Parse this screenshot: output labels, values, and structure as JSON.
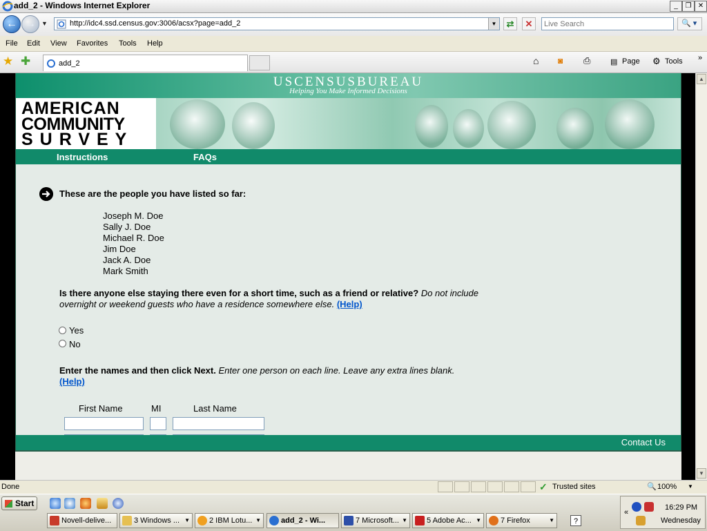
{
  "window": {
    "title": "add_2 - Windows Internet Explorer"
  },
  "address": {
    "url": "http://idc4.ssd.census.gov:3006/acsx?page=add_2",
    "search_placeholder": "Live Search"
  },
  "menu": [
    "File",
    "Edit",
    "View",
    "Favorites",
    "Tools",
    "Help"
  ],
  "tab": {
    "label": "add_2"
  },
  "commandbar": {
    "page_label": "Page",
    "tools_label": "Tools"
  },
  "banner": {
    "bureau": "USCENSUSBUREAU",
    "tagline": "Helping You Make Informed Decisions"
  },
  "logo": {
    "line1": "AMERICAN",
    "line2": "COMMUNITY",
    "line3": "SURVEY"
  },
  "nav": {
    "instructions": "Instructions",
    "faqs": "FAQs"
  },
  "listing": {
    "heading": "These are the people you have listed so far:",
    "people": [
      "Joseph M. Doe",
      "Sally J. Doe",
      "Michael R. Doe",
      "Jim Doe",
      "Jack A. Doe",
      "Mark Smith"
    ]
  },
  "question": {
    "bold": "Is there anyone else staying there even for a short time, such as a friend or relative?",
    "italic": "Do not include overnight or weekend guests who have a residence somewhere else.",
    "help": "(Help)",
    "options": [
      "Yes",
      "No"
    ]
  },
  "entry": {
    "bold": "Enter the names and then click Next.",
    "italic": "Enter one person on each line. Leave any extra lines blank.",
    "help": "(Help)",
    "col_first": "First Name",
    "col_mi": "MI",
    "col_last": "Last Name"
  },
  "footer": {
    "contact": "Contact Us"
  },
  "status": {
    "left": "Done",
    "zone": "Trusted sites",
    "zoom": "100%"
  },
  "taskbar": {
    "start": "Start",
    "tasks": [
      "Novell-delive...",
      "3 Windows ...",
      "2 IBM Lotu...",
      "add_2 - Wi...",
      "7 Microsoft...",
      "5 Adobe Ac...",
      "7 Firefox"
    ],
    "time": "16:29 PM",
    "day": "Wednesday"
  },
  "colors": {
    "census_green": "#118a6a",
    "page_bg": "#e4ebe7",
    "link": "#0055cc"
  }
}
